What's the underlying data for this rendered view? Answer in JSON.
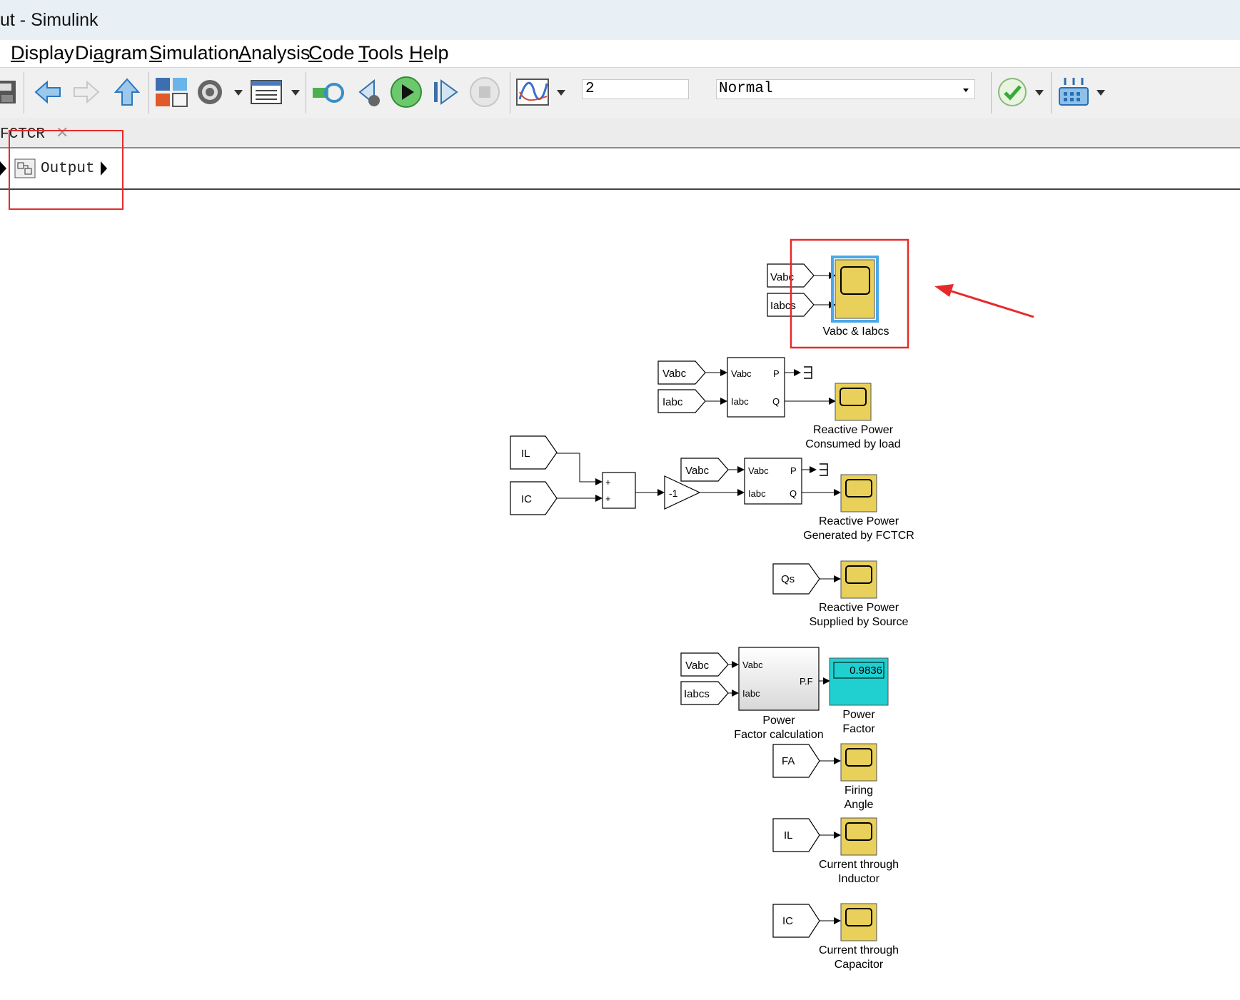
{
  "window": {
    "title": "ut - Simulink"
  },
  "menubar": {
    "items": [
      {
        "name": "menu-display",
        "label": "isplay",
        "mnemonic": "D"
      },
      {
        "name": "menu-diagram",
        "label": "Diagram",
        "mnemonic": ""
      },
      {
        "name": "menu-simulation",
        "label": "imulation",
        "mnemonic": "S"
      },
      {
        "name": "menu-analysis",
        "label": "nalysis",
        "mnemonic": "A"
      },
      {
        "name": "menu-code",
        "label": "ode",
        "mnemonic": "C"
      },
      {
        "name": "menu-tools",
        "label": "ools",
        "mnemonic": "T"
      },
      {
        "name": "menu-help",
        "label": "elp",
        "mnemonic": "H"
      }
    ]
  },
  "toolbar": {
    "stop_time": "2",
    "sim_mode": "Normal",
    "icons": [
      "save-icon",
      "back-arrow-icon",
      "forward-arrow-icon",
      "up-arrow-icon",
      "library-browser-icon",
      "model-settings-icon",
      "model-explorer-icon",
      "step-refresh-icon",
      "step-back-icon",
      "run-icon",
      "step-forward-icon",
      "stop-icon",
      "scope-icon",
      "check-icon",
      "hardware-icon"
    ]
  },
  "tabs": [
    {
      "label": "FCTCR"
    }
  ],
  "address": {
    "label": "Output"
  },
  "diagram": {
    "scope_vi": {
      "label": "Vabc & Iabcs",
      "inputs": [
        "Vabc",
        "Iabcs"
      ]
    },
    "pq_load": {
      "in_a": "Vabc",
      "in_b": "Iabc",
      "port_in1": "Vabc",
      "port_in2": "Iabc",
      "port_p": "P",
      "port_q": "Q"
    },
    "scope_load": {
      "label_line1": "Reactive Power",
      "label_line2": "Consumed by load"
    },
    "sum_inputs": {
      "in_a": "IL",
      "in_b": "IC",
      "sign_a": "+",
      "sign_b": "+"
    },
    "gain": {
      "value": "-1"
    },
    "pq_fctcr": {
      "in_a": "Vabc",
      "port_in1": "Vabc",
      "port_in2": "Iabc",
      "port_p": "P",
      "port_q": "Q"
    },
    "scope_fctcr": {
      "label_line1": "Reactive Power",
      "label_line2": "Generated by FCTCR"
    },
    "scope_source": {
      "input": "Qs",
      "label_line1": "Reactive Power",
      "label_line2": "Supplied by Source"
    },
    "pf_calc": {
      "in_a": "Vabc",
      "in_b": "Iabcs",
      "port_in1": "Vabc",
      "port_in2": "Iabc",
      "port_out": "P.F",
      "label_line1": "Power",
      "label_line2": "Factor calculation"
    },
    "pf_display": {
      "value": "0.9836",
      "label_line1": "Power",
      "label_line2": "Factor"
    },
    "scope_firing": {
      "input": "FA",
      "label_line1": "Firing",
      "label_line2": "Angle"
    },
    "scope_inductor": {
      "input": "IL",
      "label_line1": "Current through",
      "label_line2": "Inductor"
    },
    "scope_capacitor": {
      "input": "IC",
      "label_line1": "Current through",
      "label_line2": "Capacitor"
    }
  },
  "colors": {
    "scope": "#e8d05a",
    "display": "#20d0d0",
    "highlight": "#e62a2a",
    "selection": "#4aa8e8"
  }
}
